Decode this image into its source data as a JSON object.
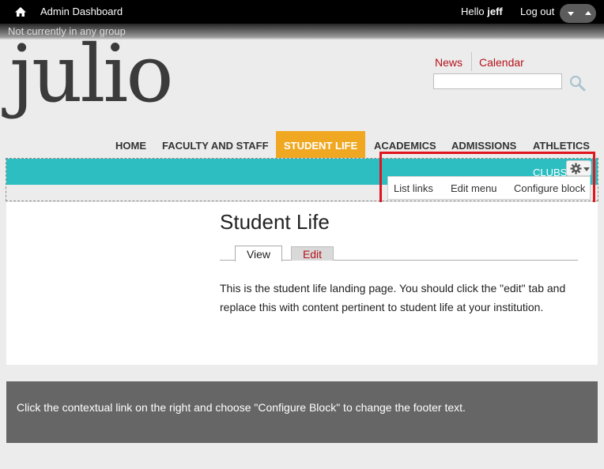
{
  "toolbar": {
    "dashboard_label": "Admin Dashboard",
    "hello_prefix": "Hello",
    "username": "jeff",
    "logout_label": "Log out"
  },
  "group_status": "Not currently in any group",
  "site": {
    "logo_text": "julio"
  },
  "secondary_nav": [
    {
      "label": "News"
    },
    {
      "label": "Calendar"
    }
  ],
  "search": {
    "value": ""
  },
  "main_nav": [
    {
      "label": "HOME"
    },
    {
      "label": "FACULTY AND STAFF"
    },
    {
      "label": "STUDENT LIFE",
      "active": true
    },
    {
      "label": "ACADEMICS"
    },
    {
      "label": "ADMISSIONS"
    },
    {
      "label": "ATHLETICS"
    }
  ],
  "sub_nav": {
    "item": "CLUBS"
  },
  "contextual_menu": {
    "links": [
      "List links",
      "Edit menu",
      "Configure block"
    ]
  },
  "page": {
    "title": "Student Life",
    "tabs": {
      "view": "View",
      "edit": "Edit"
    },
    "body": "This is the student life landing page. You should click the \"edit\" tab and replace this with content pertinent to student life at your institution."
  },
  "footer": {
    "text": "Click the contextual link on the right and choose \"Configure Block\" to change the footer text."
  },
  "colors": {
    "toolbar": "#000000",
    "accent_teal": "#2cbec0",
    "active_tab": "#f0a823",
    "link_red": "#b5121b",
    "highlight": "#e0151e",
    "footer_bg": "#666666"
  }
}
